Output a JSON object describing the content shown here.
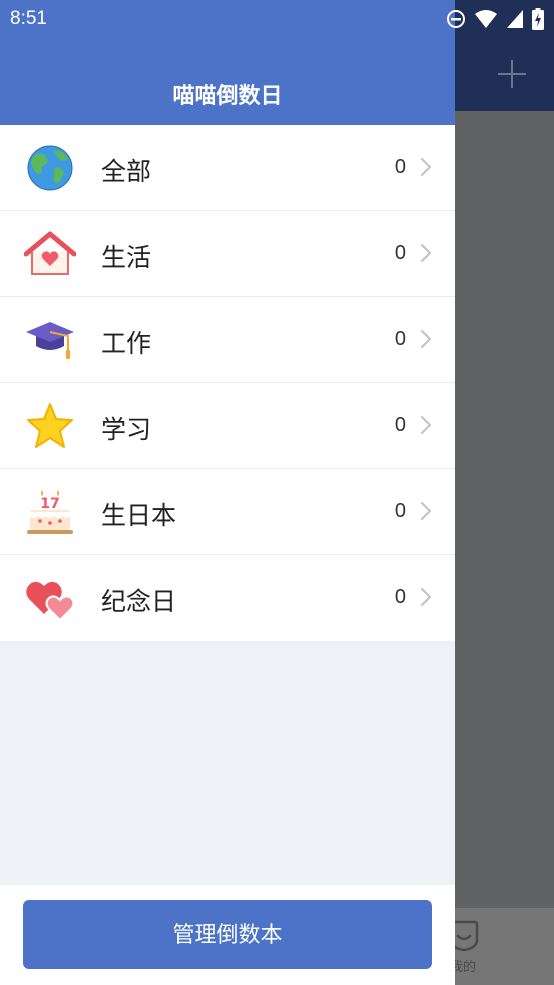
{
  "status_bar": {
    "time": "8:51"
  },
  "drawer": {
    "title": "喵喵倒数日",
    "categories": [
      {
        "icon": "globe-icon",
        "label": "全部",
        "count": "0"
      },
      {
        "icon": "house-heart-icon",
        "label": "生活",
        "count": "0"
      },
      {
        "icon": "graduation-cap-icon",
        "label": "工作",
        "count": "0"
      },
      {
        "icon": "star-icon",
        "label": "学习",
        "count": "0"
      },
      {
        "icon": "birthday-cake-icon",
        "label": "生日本",
        "count": "0"
      },
      {
        "icon": "two-hearts-icon",
        "label": "纪念日",
        "count": "0"
      }
    ],
    "manage_button": "管理倒数本"
  },
  "background": {
    "tab_label": "我的"
  },
  "colors": {
    "primary": "#4c73c7",
    "header_dark": "#1f2f55",
    "list_bg": "#eef2f6"
  }
}
